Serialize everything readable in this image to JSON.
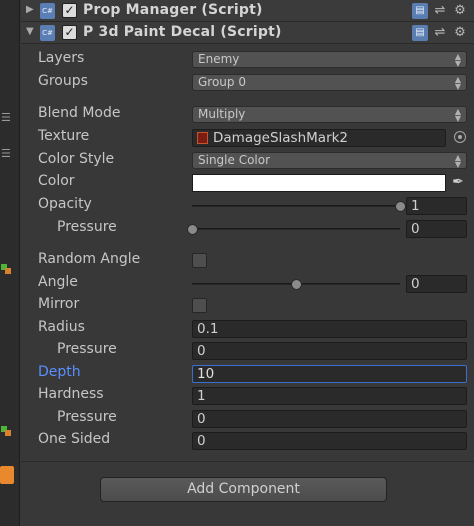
{
  "components": [
    {
      "title": "Prop Manager (Script)",
      "enabled": true,
      "expanded": false,
      "icon": "script-icon"
    },
    {
      "title": "P 3d Paint Decal (Script)",
      "enabled": true,
      "expanded": true,
      "icon": "script-icon"
    }
  ],
  "header_icons": [
    "book-help-icon",
    "preset-sliders-icon",
    "gear-icon"
  ],
  "script_icon_text": "C#",
  "fields": {
    "layers": {
      "label": "Layers",
      "value": "Enemy"
    },
    "groups": {
      "label": "Groups",
      "value": "Group 0"
    },
    "blend_mode": {
      "label": "Blend Mode",
      "value": "Multiply"
    },
    "texture": {
      "label": "Texture",
      "value": "DamageSlashMark2"
    },
    "color_style": {
      "label": "Color Style",
      "value": "Single Color"
    },
    "color": {
      "label": "Color",
      "value": "#FFFFFF"
    },
    "opacity": {
      "label": "Opacity",
      "value": "1",
      "slider_fraction": 1.0
    },
    "opacity_pressure": {
      "label": "Pressure",
      "value": "0",
      "slider_fraction": 0.0
    },
    "random_angle": {
      "label": "Random Angle",
      "checked": false
    },
    "angle": {
      "label": "Angle",
      "value": "0",
      "slider_fraction": 0.5
    },
    "mirror": {
      "label": "Mirror",
      "checked": false
    },
    "radius": {
      "label": "Radius",
      "value": "0.1"
    },
    "radius_pressure": {
      "label": "Pressure",
      "value": "0"
    },
    "depth": {
      "label": "Depth",
      "value": "10",
      "focused": true
    },
    "hardness": {
      "label": "Hardness",
      "value": "1"
    },
    "hardness_pressure": {
      "label": "Pressure",
      "value": "0"
    },
    "one_sided": {
      "label": "One Sided",
      "value": "0"
    }
  },
  "add_component_label": "Add Component",
  "colors": {
    "background": "#383838",
    "focus_label": "#5a8fff",
    "focus_border": "#3a6fcf"
  }
}
